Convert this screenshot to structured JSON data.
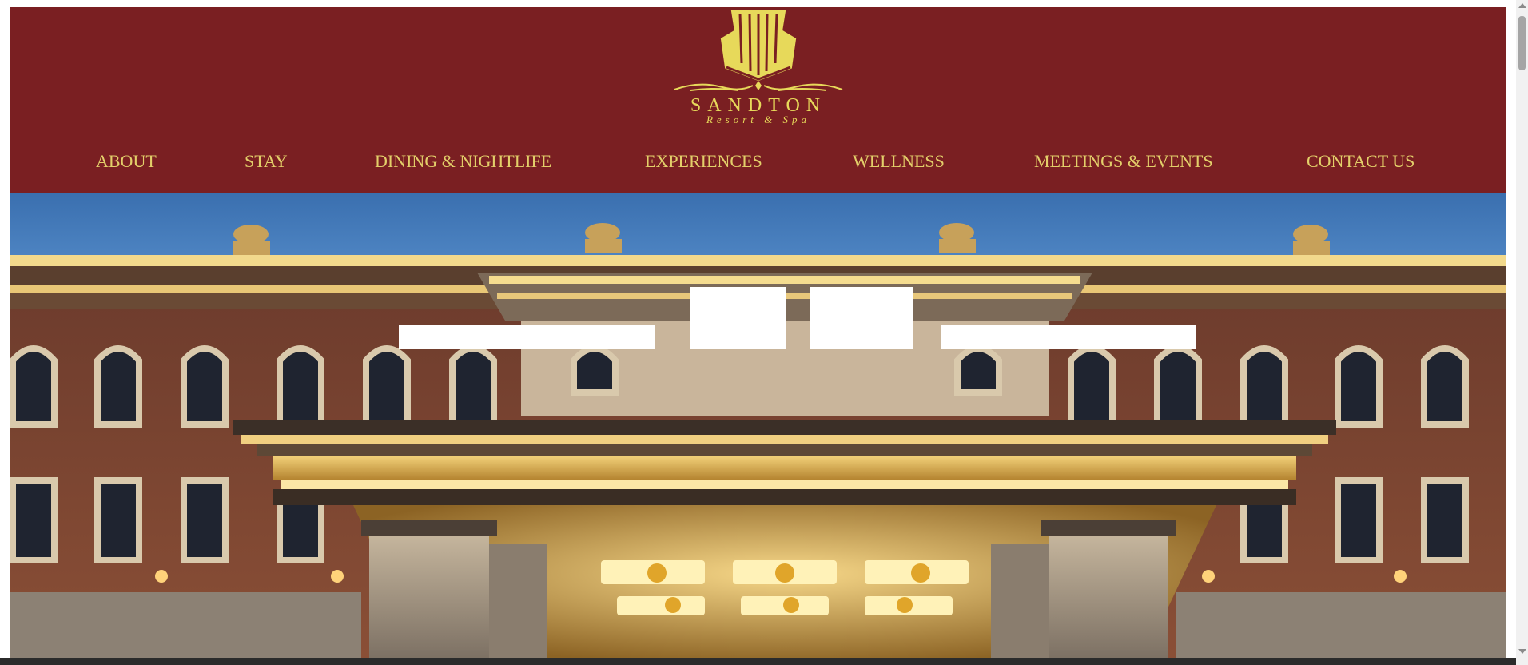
{
  "brand": {
    "name": "SANDTON",
    "tagline": "Resort & Spa",
    "logo_icon": "castle-crest-icon",
    "colors": {
      "header_bg": "#7a1f22",
      "gold": "#e7d95a",
      "nav_text": "#e3cf6a"
    }
  },
  "nav": {
    "items": [
      {
        "label": "ABOUT"
      },
      {
        "label": "STAY"
      },
      {
        "label": "DINING & NIGHTLIFE"
      },
      {
        "label": "EXPERIENCES"
      },
      {
        "label": "WELLNESS"
      },
      {
        "label": "MEETINGS & EVENTS"
      },
      {
        "label": "CONTACT US"
      }
    ]
  },
  "hero": {
    "image": "hotel-facade-night-photo",
    "sky_color": "#3e72ae"
  }
}
